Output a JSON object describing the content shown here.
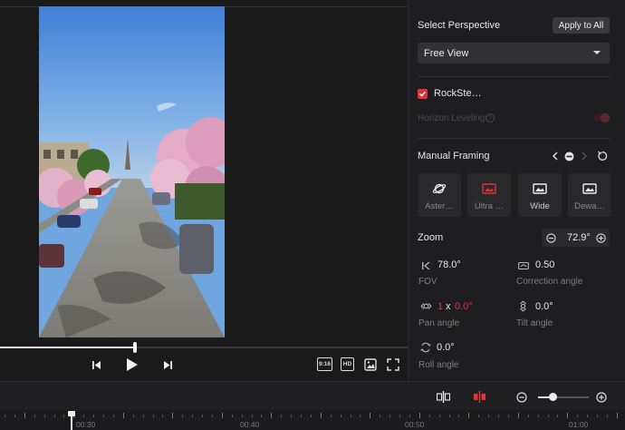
{
  "perspective": {
    "title": "Select Perspective",
    "apply_all_label": "Apply to All",
    "selected": "Free View"
  },
  "rocksteady": {
    "label": "RockSte…",
    "checked": true
  },
  "horizon": {
    "label": "Horizon Leveling",
    "enabled": false
  },
  "manual_framing": {
    "title": "Manual Framing",
    "modes": [
      {
        "name": "Aster…",
        "icon": "planet-icon"
      },
      {
        "name": "Ultra …",
        "icon": "ultra-wide-icon"
      },
      {
        "name": "Wide",
        "icon": "wide-icon"
      },
      {
        "name": "Dewa…",
        "icon": "dewarp-icon"
      }
    ]
  },
  "zoom": {
    "label": "Zoom",
    "value": "72.9°"
  },
  "params": {
    "fov": {
      "value": "78.0°",
      "label": "FOV"
    },
    "correction": {
      "value": "0.50",
      "label": "Correction angle"
    },
    "pan": {
      "multiplier": "1",
      "x": "x",
      "value": "0.0°",
      "label": "Pan angle"
    },
    "tilt": {
      "value": "0.0°",
      "label": "Tilt angle"
    },
    "roll": {
      "value": "0.0°",
      "label": "Roll angle"
    }
  },
  "player": {
    "progress": 0.33,
    "aspect_label": "9:16",
    "quality_label": "HD"
  },
  "timeline": {
    "labels": [
      "00:30",
      "00:40",
      "00:50",
      "01:00"
    ],
    "zoom_level": 0.28
  },
  "colors": {
    "accent": "#e5303d",
    "panel": "#1e1e20"
  }
}
